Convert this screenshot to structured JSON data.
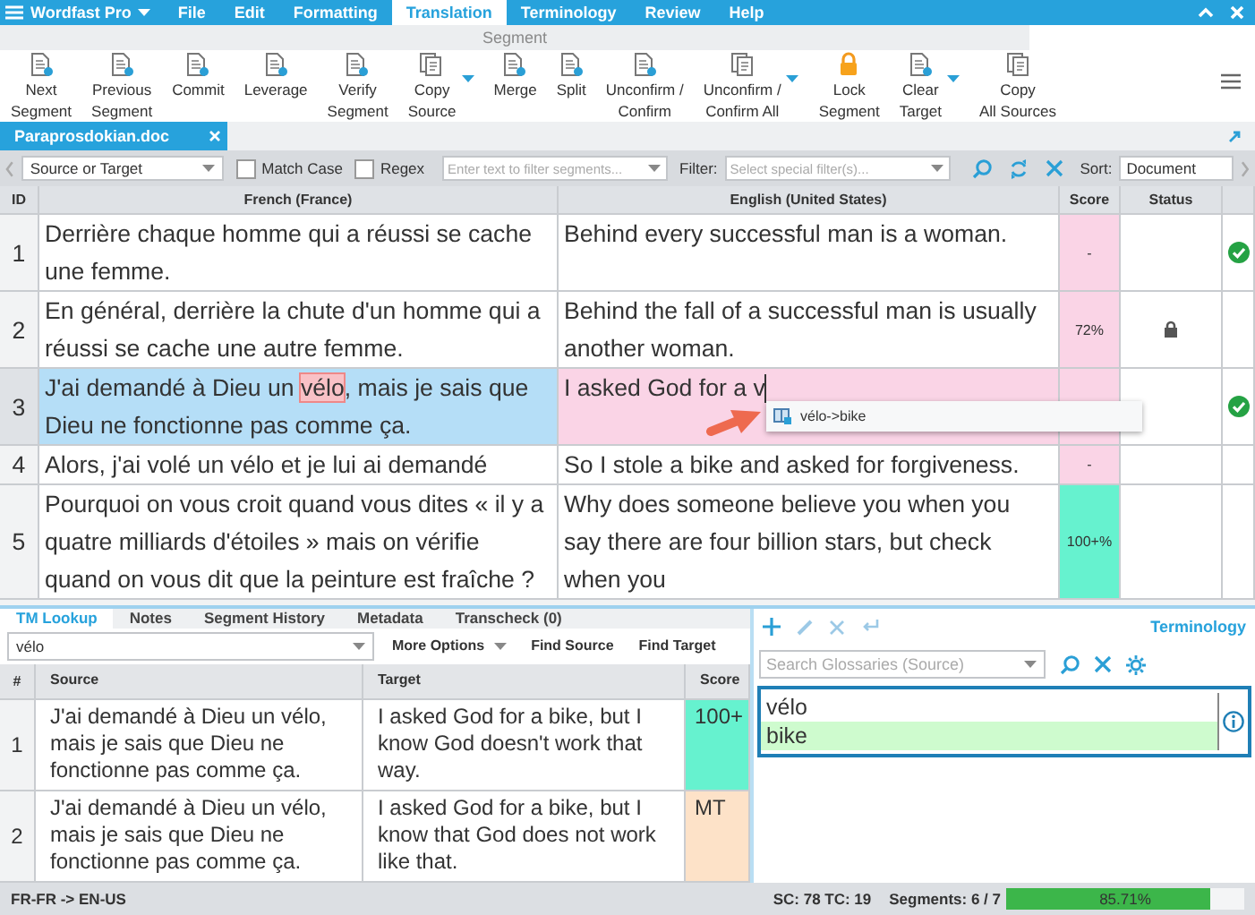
{
  "menu_bar": {
    "app": "Wordfast Pro",
    "items": [
      {
        "label": "File",
        "selected": false
      },
      {
        "label": "Edit",
        "selected": false
      },
      {
        "label": "Formatting",
        "selected": false
      },
      {
        "label": "Translation",
        "selected": true
      },
      {
        "label": "Terminology",
        "selected": false
      },
      {
        "label": "Review",
        "selected": false
      },
      {
        "label": "Help",
        "selected": false
      }
    ]
  },
  "ribbon": {
    "group": "Segment",
    "buttons": [
      {
        "label": "Next\nSegment",
        "kind": "document",
        "dropdown": false
      },
      {
        "label": "Previous\nSegment",
        "kind": "document",
        "dropdown": false
      },
      {
        "label": "Commit",
        "kind": "document",
        "dropdown": false
      },
      {
        "label": "Leverage",
        "kind": "document",
        "dropdown": false
      },
      {
        "label": "Verify\nSegment",
        "kind": "document",
        "dropdown": false
      },
      {
        "label": "Copy\nSource",
        "kind": "copy",
        "dropdown": true
      },
      {
        "label": "Merge",
        "kind": "document",
        "dropdown": false
      },
      {
        "label": "Split",
        "kind": "document",
        "dropdown": false
      },
      {
        "label": "Unconfirm /\nConfirm",
        "kind": "document",
        "dropdown": false
      },
      {
        "label": "Unconfirm /\nConfirm All",
        "kind": "copy",
        "dropdown": true
      },
      {
        "label": "Lock\nSegment",
        "kind": "lock",
        "dropdown": false
      },
      {
        "label": "Clear\nTarget",
        "kind": "document",
        "dropdown": true
      },
      {
        "label": "Copy\nAll Sources",
        "kind": "copy",
        "dropdown": false
      }
    ]
  },
  "document_tabs": [
    {
      "label": "Paraprosdokian.doc",
      "selected": true
    }
  ],
  "filter_bar": {
    "scope": "Source or Target",
    "checkboxes": [
      {
        "label": "Match Case",
        "checked": false
      },
      {
        "label": "Regex",
        "checked": false
      }
    ],
    "search": {
      "placeholder": "Enter text to filter segments..."
    },
    "filter_label": "Filter:",
    "filter": {
      "placeholder": "Select special filter(s)..."
    },
    "sort_label": "Sort:",
    "sort": "Document"
  },
  "grid": {
    "columns": [
      "ID",
      "French (France)",
      "English (United States)",
      "Score",
      "Status"
    ],
    "rows": [
      {
        "id": "1",
        "source": [
          {
            "text": "Derrière chaque homme qui a réussi se cache une femme.",
            "term": false
          }
        ],
        "target": "Behind every successful man is a woman.",
        "score": "-",
        "color": "#fad4e6",
        "locked": false,
        "confirmed": true,
        "selected": false,
        "editing": false
      },
      {
        "id": "2",
        "source": [
          {
            "text": "En général, derrière la chute d'un homme qui a réussi se cache une autre femme.",
            "term": false
          }
        ],
        "target": "Behind the fall of a successful man is usually another woman.",
        "score": "72%",
        "color": "#fad4e6",
        "locked": true,
        "confirmed": false,
        "selected": false,
        "editing": false
      },
      {
        "id": "3",
        "source": [
          {
            "text": "J'ai demandé à Dieu un ",
            "term": false
          },
          {
            "text": "vélo",
            "term": true
          },
          {
            "text": ", mais je sais que Dieu ne fonctionne pas comme ça.",
            "term": false
          }
        ],
        "target": "I asked God for a v",
        "color": "#fad4e6",
        "locked": false,
        "confirmed": true,
        "selected": true,
        "editing": true
      },
      {
        "id": "4",
        "source": [
          {
            "text": "Alors, j'ai volé un vélo et je lui ai demandé",
            "term": false
          }
        ],
        "target": "So I stole a bike and asked for forgiveness.",
        "score": "-",
        "color": "#fad4e6",
        "locked": false,
        "confirmed": false,
        "selected": false,
        "editing": false
      },
      {
        "id": "5",
        "source": [
          {
            "text": "Pourquoi on vous croit quand vous dites « il y a quatre milliards d'étoiles » mais on vérifie quand on vous dit que la peinture est fraîche ?",
            "term": false
          }
        ],
        "target": "Why does someone believe you when you say there are four billion stars, but check when you",
        "score": "100+%",
        "color": "#66f2cf",
        "locked": false,
        "confirmed": false,
        "selected": false,
        "editing": false
      }
    ]
  },
  "suggestion_popup": {
    "text": "vélo->bike"
  },
  "tm_lookup": {
    "tabs": [
      {
        "label": "TM Lookup",
        "selected": true
      },
      {
        "label": "Notes",
        "selected": false
      },
      {
        "label": "Segment History",
        "selected": false
      },
      {
        "label": "Metadata",
        "selected": false
      },
      {
        "label": "Transcheck (0)",
        "selected": false
      }
    ],
    "query": "vélo",
    "buttons": [
      {
        "label": "More Options",
        "dropdown": true
      },
      {
        "label": "Find Source",
        "dropdown": false
      },
      {
        "label": "Find Target",
        "dropdown": false
      }
    ],
    "columns": [
      "#",
      "Source",
      "Target",
      "Score"
    ],
    "rows": [
      {
        "index": "1",
        "source": "J'ai demandé à Dieu un vélo, mais je sais que Dieu ne fonctionne pas comme ça.",
        "target": "I asked God for a bike, but I know God doesn't work that way.",
        "score": "100+",
        "color": "#66f2cf"
      },
      {
        "index": "2",
        "source": "J'ai demandé à Dieu un vélo, mais je sais que Dieu ne fonctionne pas comme ça.",
        "target": "I asked God for a bike, but I know that God does not work like that.",
        "score": "MT",
        "color": "#fde2c8"
      }
    ]
  },
  "terminology": {
    "title": "Terminology",
    "search": {
      "placeholder": "Search Glossaries (Source)"
    },
    "terms": [
      {
        "text": "vélo",
        "selected": false
      },
      {
        "text": "bike",
        "selected": true
      }
    ]
  },
  "status_bar": {
    "languages": "FR-FR -> EN-US",
    "counts": "SC: 78 TC: 19",
    "segments": "Segments: 6 / 7",
    "progress": {
      "level": 0.8571,
      "reading": "85.71%"
    }
  }
}
